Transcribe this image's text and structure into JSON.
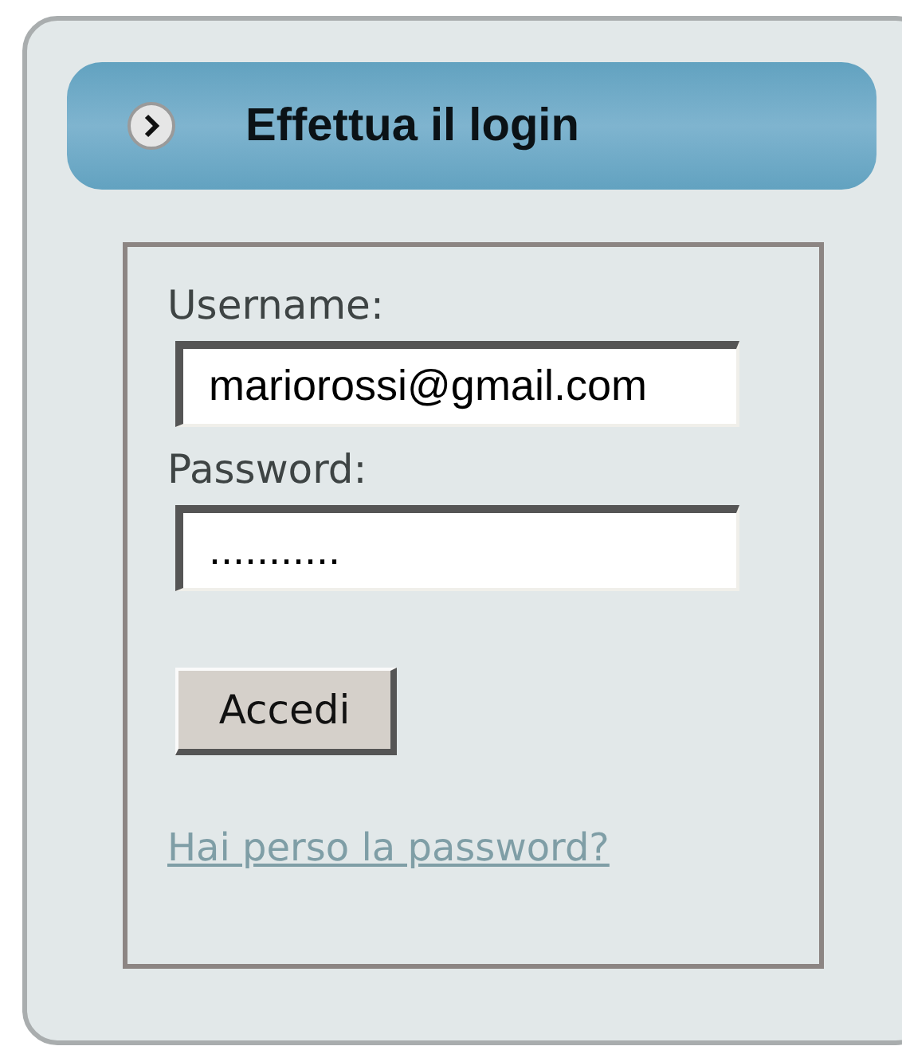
{
  "header": {
    "title": "Effettua il login"
  },
  "form": {
    "fields": [
      {
        "label": "Username:",
        "value": "mariorossi@gmail.com"
      },
      {
        "label": "Password:",
        "value": "..........."
      }
    ],
    "submit": "Accedi",
    "link": "Hai perso la password?"
  }
}
